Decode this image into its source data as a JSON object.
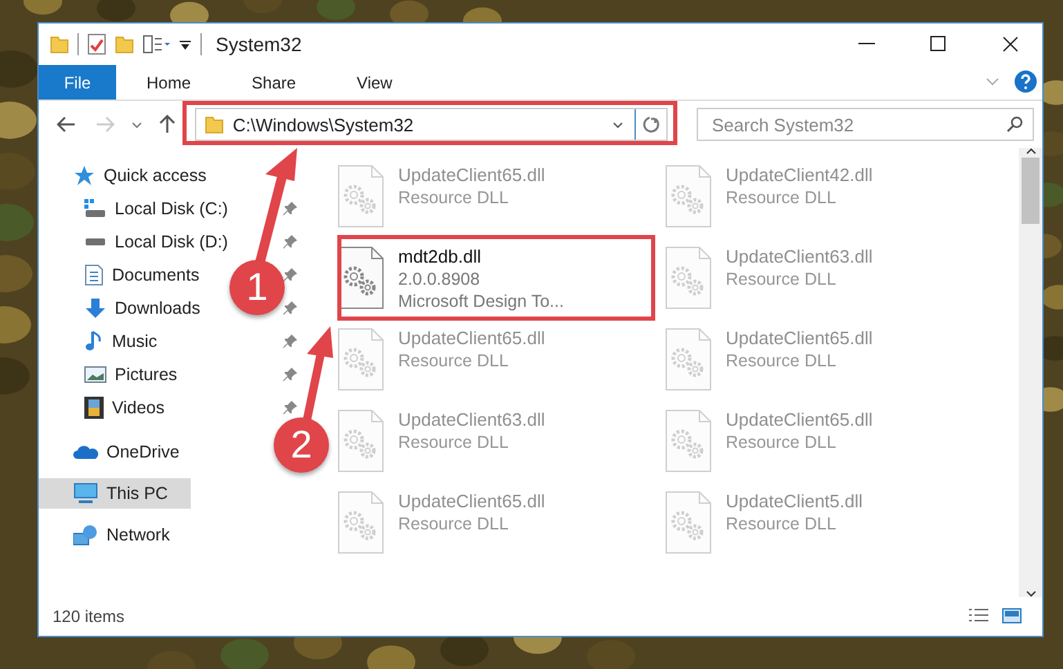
{
  "window": {
    "title": "System32"
  },
  "ribbon_tabs": [
    {
      "label": "File",
      "selected": true
    },
    {
      "label": "Home",
      "selected": false
    },
    {
      "label": "Share",
      "selected": false
    },
    {
      "label": "View",
      "selected": false
    }
  ],
  "address": {
    "path": "C:\\Windows\\System32"
  },
  "search": {
    "placeholder": "Search System32"
  },
  "nav": [
    {
      "label": "Quick access",
      "kind": "star",
      "selected": false,
      "children": [
        {
          "label": "Local Disk (C:)",
          "kind": "system-drive",
          "pinned": true,
          "selected": false
        },
        {
          "label": "Local Disk (D:)",
          "kind": "drive",
          "pinned": true,
          "selected": false
        },
        {
          "label": "Documents",
          "kind": "documents",
          "pinned": true,
          "selected": false
        },
        {
          "label": "Downloads",
          "kind": "downloads",
          "pinned": true,
          "selected": false
        },
        {
          "label": "Music",
          "kind": "music",
          "pinned": true,
          "selected": false
        },
        {
          "label": "Pictures",
          "kind": "pictures",
          "pinned": true,
          "selected": false
        },
        {
          "label": "Videos",
          "kind": "videos",
          "pinned": true,
          "selected": false
        }
      ]
    },
    {
      "label": "OneDrive",
      "kind": "cloud",
      "selected": false
    },
    {
      "label": "This PC",
      "kind": "pc",
      "selected": true
    },
    {
      "label": "Network",
      "kind": "network",
      "selected": false
    }
  ],
  "files": [
    {
      "name": "UpdateClient65.dll",
      "line_2": "Resource DLL",
      "blurred": true
    },
    {
      "name": "UpdateClient42.dll",
      "line_2": "Resource DLL",
      "blurred": true
    },
    {
      "name": "mdt2db.dll",
      "line_2": "2.0.0.8908",
      "line_3": "Microsoft Design To...",
      "blurred": false
    },
    {
      "name": "UpdateClient63.dll",
      "line_2": "Resource DLL",
      "blurred": true
    },
    {
      "name": "UpdateClient65.dll",
      "line_2": "Resource DLL",
      "blurred": true
    },
    {
      "name": "UpdateClient65.dll",
      "line_2": "Resource DLL",
      "blurred": true
    },
    {
      "name": "UpdateClient63.dll",
      "line_2": "Resource DLL",
      "blurred": true
    },
    {
      "name": "UpdateClient65.dll",
      "line_2": "Resource DLL",
      "blurred": true
    },
    {
      "name": "UpdateClient65.dll",
      "line_2": "Resource DLL",
      "blurred": true
    },
    {
      "name": "UpdateClient5.dll",
      "line_2": "Resource DLL",
      "blurred": true
    }
  ],
  "status_bar": {
    "count": "120 items"
  },
  "annotations": [
    {
      "number": "1"
    },
    {
      "number": "2"
    }
  ]
}
